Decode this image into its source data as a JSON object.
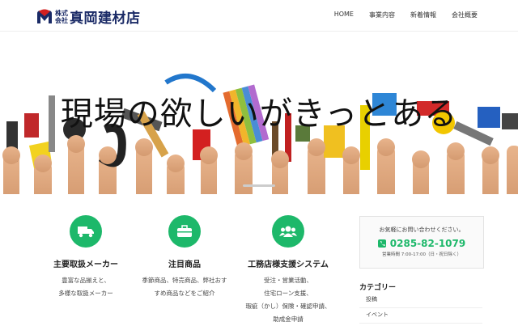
{
  "header": {
    "logo_small_top": "株式",
    "logo_small_bottom": "会社",
    "logo_main": "真岡建材店",
    "nav": [
      "HOME",
      "事業内容",
      "新着情報",
      "会社概要"
    ]
  },
  "hero": {
    "title": "現場の欲しいがきっとある"
  },
  "features": [
    {
      "icon": "truck-icon",
      "title": "主要取扱メーカー",
      "lines": [
        "豊富な品揃えと、",
        "多様な取扱メーカー"
      ]
    },
    {
      "icon": "toolbox-icon",
      "title": "注目商品",
      "lines": [
        "季節商品、特売商品、弊社おす",
        "すめ商品などをご紹介"
      ]
    },
    {
      "icon": "users-icon",
      "title": "工務店様支援システム",
      "lines": [
        "受注・営業活動、",
        "住宅ローン支援、",
        "瑕疵（かし）保険・確認申請、",
        "助成金申請"
      ]
    }
  ],
  "contact": {
    "lead": "お気軽にお問い合わせください。",
    "phone": "0285-82-1079",
    "hours": "営業時間 7:00-17:00（日・祝日除く）"
  },
  "categories": {
    "title": "カテゴリー",
    "items": [
      "投稿",
      "イベント"
    ]
  },
  "colors": {
    "accent": "#1db86a",
    "brand": "#1a2a66",
    "logo_red": "#d32020"
  }
}
